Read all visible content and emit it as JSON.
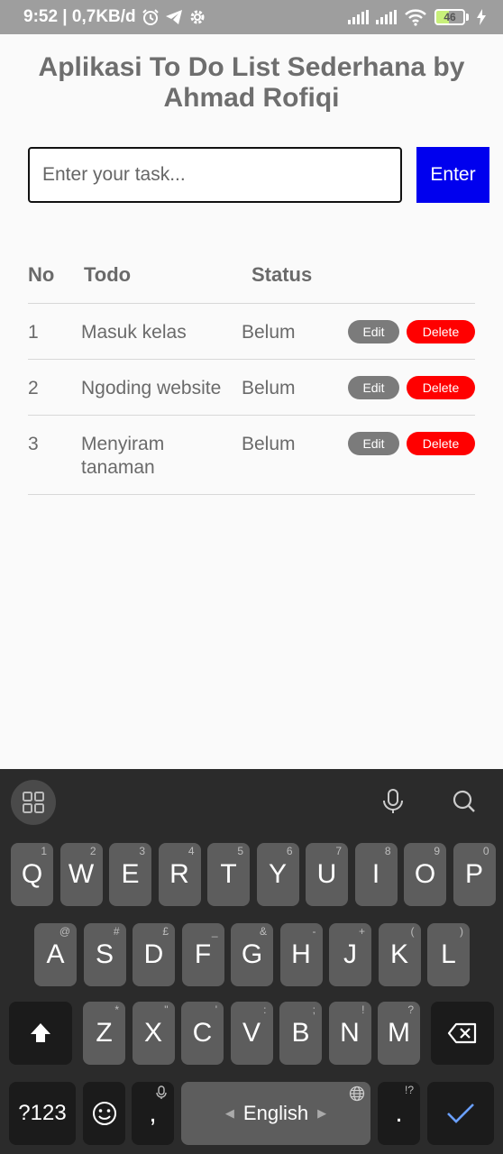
{
  "status_bar": {
    "time_speed": "9:52 | 0,7KB/d",
    "battery": "46"
  },
  "app": {
    "title": "Aplikasi To Do List Sederhana by Ahmad Rofiqi",
    "input_placeholder": "Enter your task...",
    "enter_label": "Enter"
  },
  "table": {
    "headers": {
      "no": "No",
      "todo": "Todo",
      "status": "Status"
    },
    "rows": [
      {
        "no": "1",
        "todo": "Masuk kelas",
        "status": "Belum",
        "edit": "Edit",
        "delete": "Delete"
      },
      {
        "no": "2",
        "todo": "Ngoding website",
        "status": "Belum",
        "edit": "Edit",
        "delete": "Delete"
      },
      {
        "no": "3",
        "todo": "Menyiram tanaman",
        "status": "Belum",
        "edit": "Edit",
        "delete": "Delete"
      }
    ]
  },
  "keyboard": {
    "row1": [
      "Q",
      "W",
      "E",
      "R",
      "T",
      "Y",
      "U",
      "I",
      "O",
      "P"
    ],
    "row1_hints": [
      "1",
      "2",
      "3",
      "4",
      "5",
      "6",
      "7",
      "8",
      "9",
      "0"
    ],
    "row2": [
      "A",
      "S",
      "D",
      "F",
      "G",
      "H",
      "J",
      "K",
      "L"
    ],
    "row2_hints": [
      "@",
      "#",
      "£",
      "_",
      "&",
      "-",
      "+",
      "(",
      ")"
    ],
    "row3": [
      "Z",
      "X",
      "C",
      "V",
      "B",
      "N",
      "M"
    ],
    "row3_hints": [
      "*",
      "\"",
      "'",
      ":",
      ";",
      "!",
      "?"
    ],
    "symbols_label": "?123",
    "comma": ",",
    "space_label": "English",
    "period": ".",
    "period_hint": "!?"
  }
}
